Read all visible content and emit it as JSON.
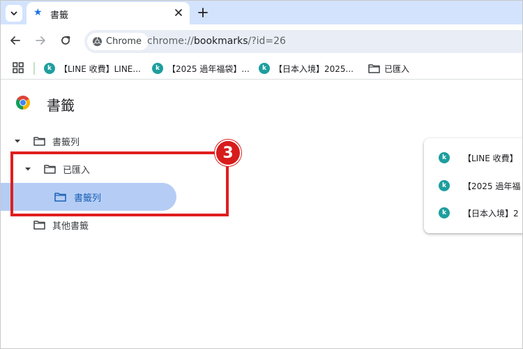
{
  "browser": {
    "tab": {
      "title": "書籤"
    },
    "omnibox": {
      "chip_label": "Chrome",
      "url_scheme": "chrome://",
      "url_host": "bookmarks",
      "url_path": "/?id=26"
    }
  },
  "bookmarks_bar": {
    "items": [
      {
        "label": "【LINE 收費】LINE...",
        "icon": "kk-site-icon"
      },
      {
        "label": "【2025 過年福袋】...",
        "icon": "kk-site-icon"
      },
      {
        "label": "【日本入境】2025...",
        "icon": "kk-site-icon"
      },
      {
        "label": "已匯入",
        "icon": "folder-icon"
      }
    ]
  },
  "page": {
    "title": "書籤"
  },
  "tree": {
    "items": [
      {
        "label": "書籤列",
        "expanded": true
      },
      {
        "label": "已匯入",
        "expanded": true
      },
      {
        "label": "書籤列",
        "selected": true
      },
      {
        "label": "其他書籤"
      }
    ]
  },
  "bookmark_list": {
    "items": [
      {
        "label": "【LINE 收費】"
      },
      {
        "label": "【2025 過年福"
      },
      {
        "label": "【日本入境】2"
      }
    ]
  },
  "annotation": {
    "badge": "3"
  },
  "colors": {
    "accent": "#1a73e8",
    "selection": "#b5cdf5",
    "annotation_red": "#e01e1e",
    "site_icon": "#1e9e9e"
  }
}
